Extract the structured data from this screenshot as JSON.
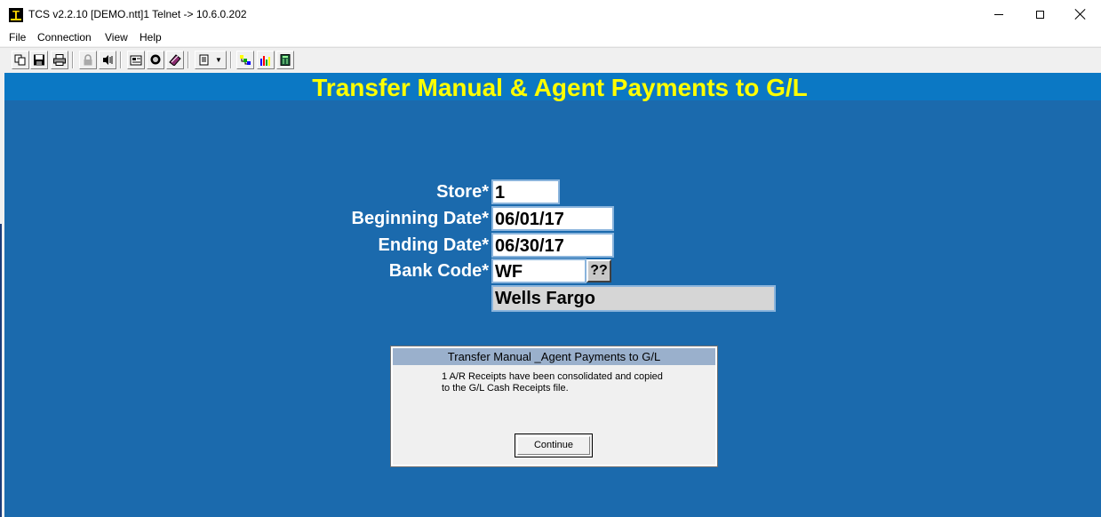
{
  "window": {
    "title": "TCS v2.2.10 [DEMO.ntt]1 Telnet -> 10.6.0.202",
    "icon": "tcs-terminal-icon"
  },
  "menu": [
    "File",
    "Connection",
    "View",
    "Help"
  ],
  "toolbar": {
    "buttons": [
      "copy-icon",
      "save-icon",
      "print-icon",
      "lock-icon",
      "audio-icon",
      "properties-icon",
      "monitor-icon",
      "book-icon",
      "dropdown-page-icon",
      "network-icon",
      "chart-icon",
      "calculator-icon"
    ]
  },
  "screen": {
    "banner": "Transfer Manual & Agent Payments to G/L",
    "colors": {
      "background": "#1b6aad",
      "banner": "#0b78c4",
      "banner_text": "#ffff00"
    },
    "fields": {
      "store": {
        "label": "Store*",
        "value": "1"
      },
      "beginning_date": {
        "label": "Beginning Date*",
        "value": "06/01/17"
      },
      "ending_date": {
        "label": "Ending Date*",
        "value": "06/30/17"
      },
      "bank_code": {
        "label": "Bank Code*",
        "value": "WF",
        "lookup_label": "??"
      }
    },
    "bank_name": "Wells Fargo"
  },
  "dialog": {
    "title": "Transfer Manual _Agent Payments to G/L",
    "message": "1 A/R Receipts have been consolidated and copied\nto the G/L Cash Receipts file.",
    "button": "Continue"
  }
}
